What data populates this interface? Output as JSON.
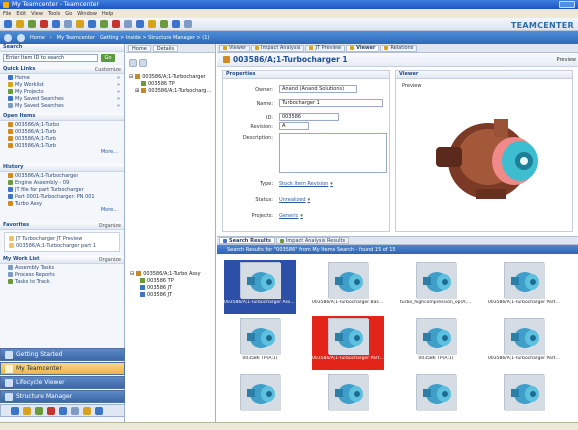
{
  "window": {
    "title": "My Teamcenter - Teamcenter",
    "menu": [
      "File",
      "Edit",
      "View",
      "Tools",
      "Go",
      "Window",
      "Help"
    ],
    "brand": "TEAMCENTER",
    "nav": {
      "crumb_home": "Home",
      "crumb_mytc": "My Teamcenter",
      "crumb_path": "Getting > Inside > Structure Manager > (1)"
    }
  },
  "left": {
    "search": {
      "title": "Search",
      "value": "Enter Item ID to search",
      "go": "Go"
    },
    "quick_links": {
      "title": "Quick Links",
      "more": "Customize",
      "items": [
        "Home",
        "My Worklist",
        "My Projects",
        "My Saved Searches",
        "My Saved Searches"
      ]
    },
    "open_items": {
      "title": "Open Items",
      "items": [
        "003586/A;1-Turbo",
        "003586/A;1-Turb",
        "003586/A;1-Turb",
        "003586/A;1-Turb"
      ],
      "more": "More..."
    },
    "history": {
      "title": "History",
      "items": [
        "003586/A;1-Turbocharger",
        "Engine Assembly - 09",
        "JT file for part Turbocharger",
        "Part 0001-Turbocharger: PN 001",
        "Turbo Assy"
      ],
      "more": "More..."
    },
    "favorites": {
      "title": "Favorites",
      "more": "Organize",
      "items": [
        "JT Turbocharger JT Preview",
        "003586/A;1-Turbocharger part 1"
      ]
    },
    "my_work": {
      "title": "My Work List",
      "more": "Organize",
      "items": [
        "Assembly Tasks",
        "Process Reports",
        "Tasks to Track"
      ]
    },
    "apps": [
      "Getting Started",
      "My Teamcenter",
      "Lifecycle Viewer",
      "Structure Manager"
    ]
  },
  "tree": {
    "tabs": [
      "Home",
      "Details"
    ],
    "nodes": [
      "003586/A;1-Turbocharger",
      "003586 TP",
      "003586/A;1-Turbocharger part"
    ],
    "lower_nodes": [
      "003586/A;1-Turbo Assy",
      "003586 TP",
      "003586 JT",
      "003586 JT"
    ]
  },
  "editor": {
    "tabs": [
      "Viewer",
      "Impact Analysis",
      "JT Preview",
      "Viewer",
      "Relations"
    ],
    "object_title": "003586/A;1-Turbocharger 1",
    "header_action": "Preview",
    "properties": {
      "title": "Properties",
      "owner_label": "Owner:",
      "owner_value": "Anand (Anand Solutions)",
      "name_label": "Name:",
      "name_value": "Turbocharger 1",
      "id_label": "ID:",
      "id_value": "003586",
      "revision_label": "Revision:",
      "revision_value": "A",
      "description_label": "Description:",
      "type_label": "Type:",
      "type_value": "Stock Item Revision",
      "status_label": "Status:",
      "status_value": "Unrealized",
      "project_label": "Projects:",
      "project_value": "Generic"
    },
    "viewer": {
      "title": "Viewer",
      "label": "Preview"
    }
  },
  "bottom": {
    "tabs": [
      "Search Results",
      "Impact Analysis Results"
    ],
    "results_header": "Search Results for \"003586\" from My Items Search - found 15 of 15",
    "results": [
      "003586/A;1-Turbocharger Assembly",
      "003586/A;1-Turbocharger Base(A;1)",
      "turbo_highcompression_op(A;1 Rev B)",
      "003586/A;1-Turbocharger Part(A)",
      "003586 TP(A;1)",
      "003586/A;1-Turbocharger Part(A)",
      "003586 TP(A;1)",
      "003586/A;1-Turbocharger Part(A)",
      "",
      "",
      "",
      ""
    ]
  },
  "colors": {
    "titlebar": "#2a64cf",
    "nav_blue": "#2c68b8",
    "selected_blue": "#2c4fa8",
    "selected_red": "#e32418",
    "favorite_orange": "#f0c36a"
  }
}
